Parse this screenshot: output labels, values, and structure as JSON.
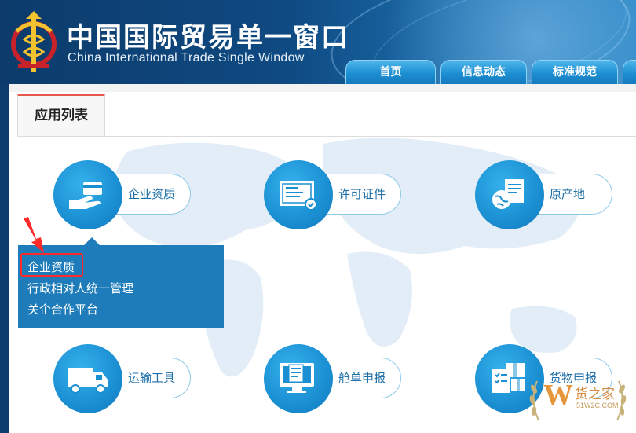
{
  "header": {
    "title_cn": "中国国际贸易单一窗口",
    "title_en": "China International Trade Single Window",
    "nav_tabs": [
      {
        "label": "首页"
      },
      {
        "label": "信息动态"
      },
      {
        "label": "标准规范"
      },
      {
        "label": ""
      }
    ]
  },
  "content": {
    "tab_label": "应用列表",
    "apps": [
      {
        "label": "企业资质",
        "icon": "card-hand-icon"
      },
      {
        "label": "许可证件",
        "icon": "certificate-icon"
      },
      {
        "label": "原产地",
        "icon": "globe-document-icon"
      },
      {
        "label": "运输工具",
        "icon": "truck-icon"
      },
      {
        "label": "舱单申报",
        "icon": "monitor-document-icon"
      },
      {
        "label": "货物申报",
        "icon": "boxes-document-icon"
      }
    ],
    "dropdown": {
      "items": [
        {
          "label": "企业资质"
        },
        {
          "label": "行政相对人统一管理"
        },
        {
          "label": "关企合作平台"
        }
      ]
    }
  },
  "watermark": {
    "brand": "货之家",
    "url": "51W2C.COM",
    "letter": "W"
  },
  "colors": {
    "header_dark": "#0c3b6b",
    "accent_blue": "#1a8fd2",
    "dropdown_bg": "#1f7cba",
    "highlight_red": "#ff2a2a",
    "tab_top_border": "#e45a4d"
  }
}
